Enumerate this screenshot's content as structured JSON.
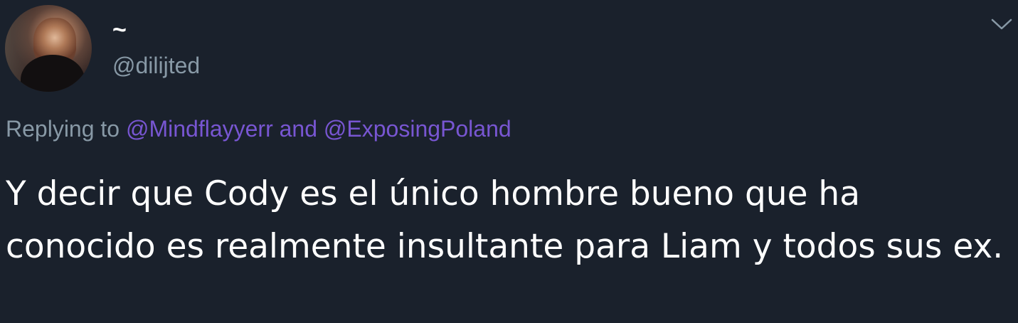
{
  "author": {
    "display_name": "~",
    "handle": "@dilijted"
  },
  "reply": {
    "prefix": "Replying to",
    "mention_1": "@Mindflayyerr",
    "conjunction": "and",
    "mention_2": "@ExposingPoland"
  },
  "tweet": {
    "text": "Y decir que Cody es el único hombre bueno que ha conocido es realmente insultante para Liam y todos sus ex."
  },
  "icons": {
    "menu": "chevron-down-icon"
  },
  "colors": {
    "background": "#1a212c",
    "muted_text": "#8899a6",
    "mention": "#7856d2",
    "text": "#ffffff"
  }
}
